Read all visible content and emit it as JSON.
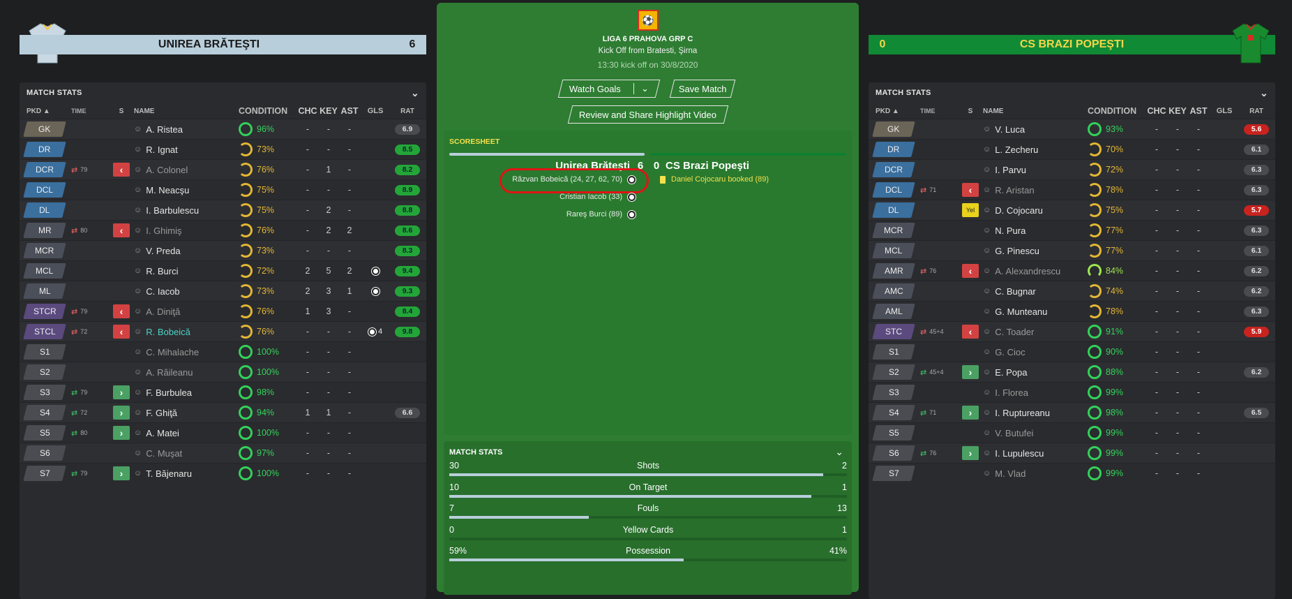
{
  "home": {
    "name": "UNIREA BRĂTEŞTI",
    "score": "6",
    "stats_title": "MATCH STATS",
    "headers": [
      "PKD",
      "TIME",
      "S",
      "NAME",
      "CONDITION",
      "CHC",
      "KEY",
      "AST",
      "GLS",
      "RAT"
    ],
    "players": [
      {
        "pos": "GK",
        "pcls": "pgk",
        "time": "",
        "s": "",
        "name": "A. Ristea",
        "cond": "96%",
        "ccls": "g",
        "chc": "-",
        "key": "-",
        "ast": "-",
        "gls": "",
        "rat": "6.9",
        "rcls": "grey",
        "dim": false
      },
      {
        "pos": "DR",
        "pcls": "pdef",
        "time": "",
        "s": "",
        "name": "R. Ignat",
        "cond": "73%",
        "ccls": "y",
        "chc": "-",
        "key": "-",
        "ast": "-",
        "gls": "",
        "rat": "8.5",
        "rcls": "green",
        "dim": false
      },
      {
        "pos": "DCR",
        "pcls": "pdef",
        "time": "79",
        "s": "off",
        "name": "A. Colonel",
        "cond": "76%",
        "ccls": "y",
        "chc": "-",
        "key": "1",
        "ast": "-",
        "gls": "",
        "rat": "8.2",
        "rcls": "green",
        "dim": true
      },
      {
        "pos": "DCL",
        "pcls": "pdef",
        "time": "",
        "s": "",
        "name": "M. Neacşu",
        "cond": "75%",
        "ccls": "y",
        "chc": "-",
        "key": "-",
        "ast": "-",
        "gls": "",
        "rat": "8.9",
        "rcls": "green",
        "dim": false
      },
      {
        "pos": "DL",
        "pcls": "pdef",
        "time": "",
        "s": "",
        "name": "I. Barbulescu",
        "cond": "75%",
        "ccls": "y",
        "chc": "-",
        "key": "2",
        "ast": "-",
        "gls": "",
        "rat": "8.8",
        "rcls": "green",
        "dim": false
      },
      {
        "pos": "MR",
        "pcls": "pmid",
        "time": "80",
        "s": "off",
        "name": "I. Ghimiş",
        "cond": "76%",
        "ccls": "y",
        "chc": "-",
        "key": "2",
        "ast": "2",
        "gls": "",
        "rat": "8.6",
        "rcls": "green",
        "dim": true
      },
      {
        "pos": "MCR",
        "pcls": "pmid",
        "time": "",
        "s": "",
        "name": "V. Preda",
        "cond": "73%",
        "ccls": "y",
        "chc": "-",
        "key": "-",
        "ast": "-",
        "gls": "",
        "rat": "8.3",
        "rcls": "green",
        "dim": false
      },
      {
        "pos": "MCL",
        "pcls": "pmid",
        "time": "",
        "s": "",
        "name": "R. Burci",
        "cond": "72%",
        "ccls": "y",
        "chc": "2",
        "key": "5",
        "ast": "2",
        "gls": "ball",
        "rat": "9.4",
        "rcls": "green",
        "dim": false
      },
      {
        "pos": "ML",
        "pcls": "pmid",
        "time": "",
        "s": "",
        "name": "C. Iacob",
        "cond": "73%",
        "ccls": "y",
        "chc": "2",
        "key": "3",
        "ast": "1",
        "gls": "ball",
        "rat": "9.3",
        "rcls": "green",
        "dim": false
      },
      {
        "pos": "STCR",
        "pcls": "patt",
        "time": "79",
        "s": "off",
        "name": "A. Diniţă",
        "cond": "76%",
        "ccls": "y",
        "chc": "1",
        "key": "3",
        "ast": "-",
        "gls": "",
        "rat": "8.4",
        "rcls": "green",
        "dim": true
      },
      {
        "pos": "STCL",
        "pcls": "patt",
        "time": "72",
        "s": "off",
        "name": "R. Bobeică",
        "cond": "76%",
        "ccls": "y",
        "chc": "-",
        "key": "-",
        "ast": "-",
        "gls": "4",
        "rat": "9.8",
        "rcls": "green",
        "dim": false,
        "hl": true
      },
      {
        "pos": "S1",
        "pcls": "psub",
        "time": "",
        "s": "",
        "name": "C. Mihalache",
        "cond": "100%",
        "ccls": "g",
        "chc": "-",
        "key": "-",
        "ast": "-",
        "gls": "",
        "rat": "",
        "rcls": "",
        "dim": true
      },
      {
        "pos": "S2",
        "pcls": "psub",
        "time": "",
        "s": "",
        "name": "A. Răileanu",
        "cond": "100%",
        "ccls": "g",
        "chc": "-",
        "key": "-",
        "ast": "-",
        "gls": "",
        "rat": "",
        "rcls": "",
        "dim": true
      },
      {
        "pos": "S3",
        "pcls": "psub",
        "time": "79",
        "s": "on",
        "name": "F. Burbulea",
        "cond": "98%",
        "ccls": "g",
        "chc": "-",
        "key": "-",
        "ast": "-",
        "gls": "",
        "rat": "",
        "rcls": "",
        "dim": false
      },
      {
        "pos": "S4",
        "pcls": "psub",
        "time": "72",
        "s": "on",
        "name": "F. Ghiţă",
        "cond": "94%",
        "ccls": "g",
        "chc": "1",
        "key": "1",
        "ast": "-",
        "gls": "",
        "rat": "6.6",
        "rcls": "grey",
        "dim": false
      },
      {
        "pos": "S5",
        "pcls": "psub",
        "time": "80",
        "s": "on",
        "name": "A. Matei",
        "cond": "100%",
        "ccls": "g",
        "chc": "-",
        "key": "-",
        "ast": "-",
        "gls": "",
        "rat": "",
        "rcls": "",
        "dim": false
      },
      {
        "pos": "S6",
        "pcls": "psub",
        "time": "",
        "s": "",
        "name": "C. Muşat",
        "cond": "97%",
        "ccls": "g",
        "chc": "-",
        "key": "-",
        "ast": "-",
        "gls": "",
        "rat": "",
        "rcls": "",
        "dim": true
      },
      {
        "pos": "S7",
        "pcls": "psub",
        "time": "79",
        "s": "on",
        "name": "T. Băjenaru",
        "cond": "100%",
        "ccls": "g",
        "chc": "-",
        "key": "-",
        "ast": "-",
        "gls": "",
        "rat": "",
        "rcls": "",
        "dim": false
      }
    ]
  },
  "away": {
    "name": "CS BRAZI POPEŞTI",
    "score": "0",
    "stats_title": "MATCH STATS",
    "headers": [
      "PKD",
      "TIME",
      "S",
      "NAME",
      "CONDITION",
      "CHC",
      "KEY",
      "AST",
      "GLS",
      "RAT"
    ],
    "players": [
      {
        "pos": "GK",
        "pcls": "pgk",
        "time": "",
        "s": "",
        "name": "V. Luca",
        "cond": "93%",
        "ccls": "g",
        "chc": "-",
        "key": "-",
        "ast": "-",
        "gls": "",
        "rat": "5.6",
        "rcls": "red",
        "dim": false
      },
      {
        "pos": "DR",
        "pcls": "pdef",
        "time": "",
        "s": "",
        "name": "L. Zecheru",
        "cond": "70%",
        "ccls": "y",
        "chc": "-",
        "key": "-",
        "ast": "-",
        "gls": "",
        "rat": "6.1",
        "rcls": "grey",
        "dim": false
      },
      {
        "pos": "DCR",
        "pcls": "pdef",
        "time": "",
        "s": "",
        "name": "I. Parvu",
        "cond": "72%",
        "ccls": "y",
        "chc": "-",
        "key": "-",
        "ast": "-",
        "gls": "",
        "rat": "6.3",
        "rcls": "grey",
        "dim": false
      },
      {
        "pos": "DCL",
        "pcls": "pdef",
        "time": "71",
        "s": "off",
        "name": "R. Aristan",
        "cond": "78%",
        "ccls": "y",
        "chc": "-",
        "key": "-",
        "ast": "-",
        "gls": "",
        "rat": "6.3",
        "rcls": "grey",
        "dim": true
      },
      {
        "pos": "DL",
        "pcls": "pdef",
        "time": "",
        "s": "yel",
        "name": "D. Cojocaru",
        "cond": "75%",
        "ccls": "y",
        "chc": "-",
        "key": "-",
        "ast": "-",
        "gls": "",
        "rat": "5.7",
        "rcls": "red",
        "dim": false
      },
      {
        "pos": "MCR",
        "pcls": "pmid",
        "time": "",
        "s": "",
        "name": "N. Pura",
        "cond": "77%",
        "ccls": "y",
        "chc": "-",
        "key": "-",
        "ast": "-",
        "gls": "",
        "rat": "6.3",
        "rcls": "grey",
        "dim": false
      },
      {
        "pos": "MCL",
        "pcls": "pmid",
        "time": "",
        "s": "",
        "name": "G. Pinescu",
        "cond": "77%",
        "ccls": "y",
        "chc": "-",
        "key": "-",
        "ast": "-",
        "gls": "",
        "rat": "6.1",
        "rcls": "grey",
        "dim": false
      },
      {
        "pos": "AMR",
        "pcls": "pmid",
        "time": "76",
        "s": "off",
        "name": "A. Alexandrescu",
        "cond": "84%",
        "ccls": "lg",
        "chc": "-",
        "key": "-",
        "ast": "-",
        "gls": "",
        "rat": "6.2",
        "rcls": "grey",
        "dim": true
      },
      {
        "pos": "AMC",
        "pcls": "pmid",
        "time": "",
        "s": "",
        "name": "C. Bugnar",
        "cond": "74%",
        "ccls": "y",
        "chc": "-",
        "key": "-",
        "ast": "-",
        "gls": "",
        "rat": "6.2",
        "rcls": "grey",
        "dim": false
      },
      {
        "pos": "AML",
        "pcls": "pmid",
        "time": "",
        "s": "",
        "name": "G. Munteanu",
        "cond": "78%",
        "ccls": "y",
        "chc": "-",
        "key": "-",
        "ast": "-",
        "gls": "",
        "rat": "6.3",
        "rcls": "grey",
        "dim": false
      },
      {
        "pos": "STC",
        "pcls": "patt",
        "time": "45+4",
        "s": "off",
        "name": "C. Toader",
        "cond": "91%",
        "ccls": "g",
        "chc": "-",
        "key": "-",
        "ast": "-",
        "gls": "",
        "rat": "5.9",
        "rcls": "red",
        "dim": true
      },
      {
        "pos": "S1",
        "pcls": "psub",
        "time": "",
        "s": "",
        "name": "G. Cioc",
        "cond": "90%",
        "ccls": "g",
        "chc": "-",
        "key": "-",
        "ast": "-",
        "gls": "",
        "rat": "",
        "rcls": "",
        "dim": true
      },
      {
        "pos": "S2",
        "pcls": "psub",
        "time": "45+4",
        "s": "on",
        "name": "E. Popa",
        "cond": "88%",
        "ccls": "g",
        "chc": "-",
        "key": "-",
        "ast": "-",
        "gls": "",
        "rat": "6.2",
        "rcls": "grey",
        "dim": false
      },
      {
        "pos": "S3",
        "pcls": "psub",
        "time": "",
        "s": "",
        "name": "I. Florea",
        "cond": "99%",
        "ccls": "g",
        "chc": "-",
        "key": "-",
        "ast": "-",
        "gls": "",
        "rat": "",
        "rcls": "",
        "dim": true
      },
      {
        "pos": "S4",
        "pcls": "psub",
        "time": "71",
        "s": "on",
        "name": "I. Ruptureanu",
        "cond": "98%",
        "ccls": "g",
        "chc": "-",
        "key": "-",
        "ast": "-",
        "gls": "",
        "rat": "6.5",
        "rcls": "grey",
        "dim": false
      },
      {
        "pos": "S5",
        "pcls": "psub",
        "time": "",
        "s": "",
        "name": "V. Butufei",
        "cond": "99%",
        "ccls": "g",
        "chc": "-",
        "key": "-",
        "ast": "-",
        "gls": "",
        "rat": "",
        "rcls": "",
        "dim": true
      },
      {
        "pos": "S6",
        "pcls": "psub",
        "time": "76",
        "s": "on",
        "name": "I. Lupulescu",
        "cond": "99%",
        "ccls": "g",
        "chc": "-",
        "key": "-",
        "ast": "-",
        "gls": "",
        "rat": "",
        "rcls": "",
        "dim": false
      },
      {
        "pos": "S7",
        "pcls": "psub",
        "time": "",
        "s": "",
        "name": "M. Vlad",
        "cond": "99%",
        "ccls": "g",
        "chc": "-",
        "key": "-",
        "ast": "-",
        "gls": "",
        "rat": "",
        "rcls": "",
        "dim": true
      }
    ]
  },
  "match": {
    "league": "LIGA 6 PRAHOVA GRP C",
    "kickoff": "Kick Off from Bratesti, Şirna",
    "time": "13:30 kick off on 30/8/2020",
    "watch_goals": "Watch Goals",
    "save_match": "Save Match",
    "review": "Review and Share Highlight Video",
    "sheet_title": "SCORESHEET",
    "home_team": "Unirea Brăteşti",
    "away_team": "CS Brazi Popeşti",
    "home_score": "6",
    "away_score": "0",
    "home_events": [
      "Răzvan Bobeică (24, 27, 62, 70)",
      "Cristian Iacob (33)",
      "Rareş Burci (89)"
    ],
    "away_events": [
      "Daniel Cojocaru booked (89)"
    ],
    "stats_title": "MATCH STATS",
    "stats": [
      {
        "label": "Shots",
        "home": "30",
        "away": "2",
        "home_share": 0.94
      },
      {
        "label": "On Target",
        "home": "10",
        "away": "1",
        "home_share": 0.91
      },
      {
        "label": "Fouls",
        "home": "7",
        "away": "13",
        "home_share": 0.35
      },
      {
        "label": "Yellow Cards",
        "home": "0",
        "away": "1",
        "home_share": 0.0
      },
      {
        "label": "Possession",
        "home": "59%",
        "away": "41%",
        "home_share": 0.59
      }
    ]
  },
  "colors": {
    "home_banner": "#b9cedb",
    "away_banner": "#108a34",
    "away_text": "#f4d64a",
    "center_bg": "#2e7d32"
  }
}
